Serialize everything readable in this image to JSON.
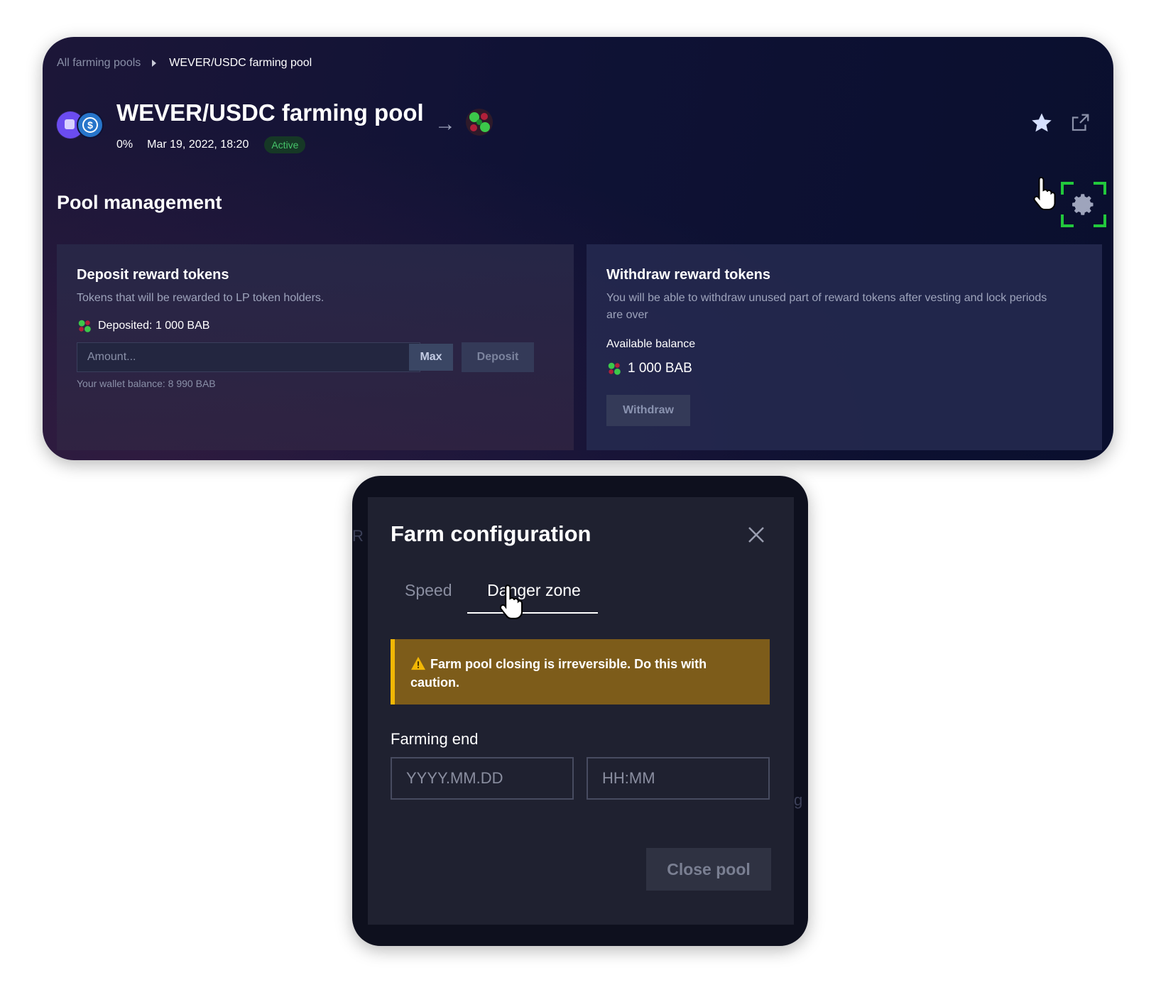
{
  "breadcrumb": {
    "parent": "All farming pools",
    "current": "WEVER/USDC farming pool"
  },
  "pool": {
    "title": "WEVER/USDC farming pool",
    "percent": "0%",
    "date": "Mar 19, 2022, 18:20",
    "status": "Active",
    "token_icons": [
      "wever-icon",
      "usdc-icon"
    ],
    "reward_icon": "bab-token-icon"
  },
  "management": {
    "title": "Pool management",
    "deposit": {
      "title": "Deposit reward tokens",
      "description": "Tokens that will be rewarded to LP token holders.",
      "deposited": "Deposited: 1 000 BAB",
      "amount_placeholder": "Amount...",
      "max_label": "Max",
      "deposit_label": "Deposit",
      "wallet_balance": "Your wallet balance: 8 990 BAB"
    },
    "withdraw": {
      "title": "Withdraw reward tokens",
      "description": "You will be able to withdraw unused part of reward tokens after vesting and lock periods are over",
      "available_label": "Available balance",
      "available_value": "1 000 BAB",
      "withdraw_label": "Withdraw"
    }
  },
  "modal": {
    "title": "Farm configuration",
    "tabs": [
      {
        "label": "Speed",
        "active": false
      },
      {
        "label": "Danger zone",
        "active": true
      }
    ],
    "warning": "Farm pool closing is irreversible. Do this with caution.",
    "farming_end_label": "Farming end",
    "date_placeholder": "YYYY.MM.DD",
    "time_placeholder": "HH:MM",
    "close_pool_label": "Close pool",
    "backdrop_fragments": [
      "R",
      "g"
    ]
  },
  "colors": {
    "active_green": "#46c36a",
    "focus_green": "#22c83c",
    "warning_bg": "#7d5c1a",
    "warning_border": "#f2b705"
  }
}
